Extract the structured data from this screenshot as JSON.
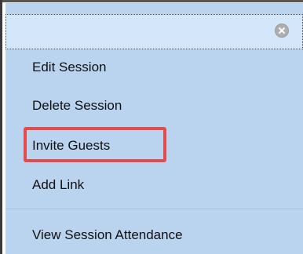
{
  "menu": {
    "close_icon": "close-icon",
    "items": [
      {
        "label": "Edit Session"
      },
      {
        "label": "Delete Session"
      },
      {
        "label": "Invite Guests"
      },
      {
        "label": "Add Link"
      },
      {
        "label": "View Session Attendance"
      }
    ]
  },
  "colors": {
    "menu_background": "#bad3ef",
    "header_background": "#d4e6fa",
    "highlight": "#e24c4c"
  }
}
